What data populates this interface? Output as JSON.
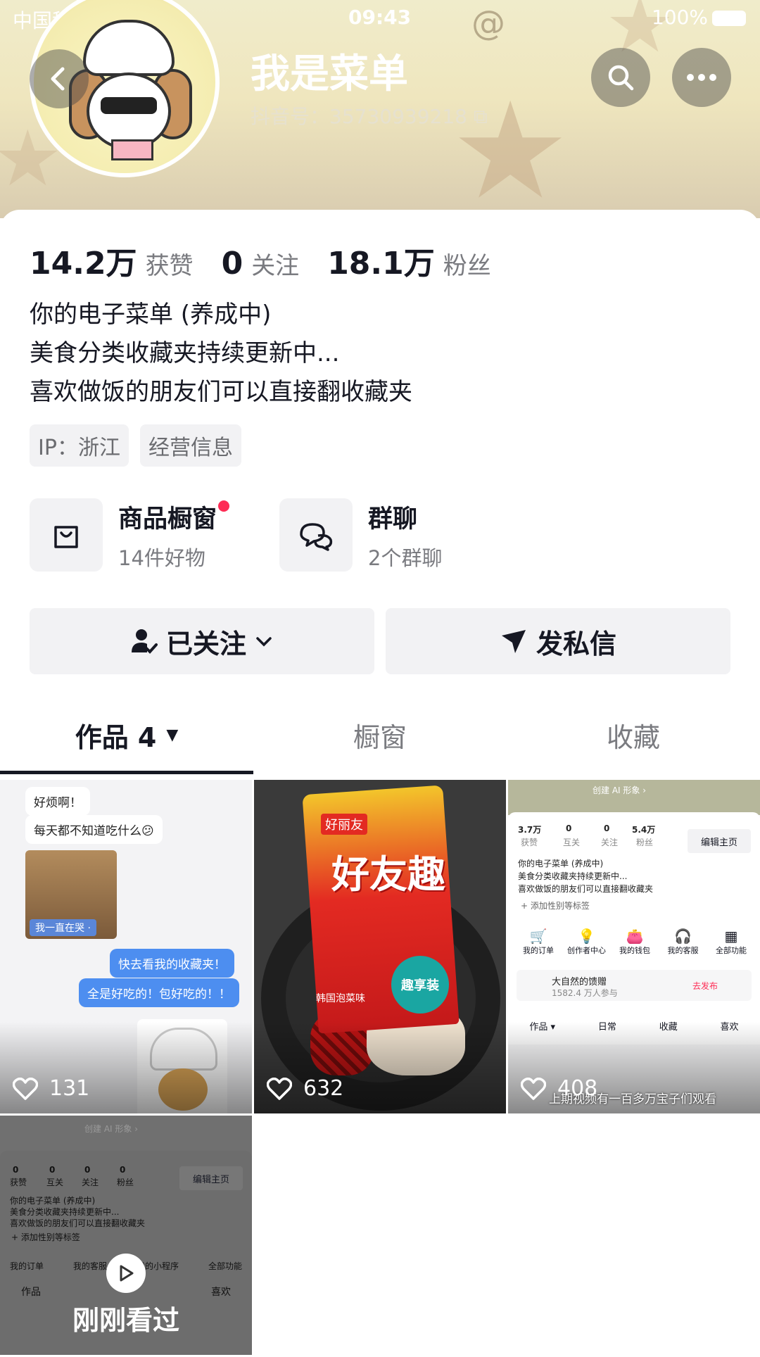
{
  "status_bar": {
    "carrier": "中国移动",
    "time": "09:43",
    "battery": "100%"
  },
  "profile": {
    "nickname": "我是菜单",
    "douyin_id": "抖音号：35730939218",
    "stats": [
      {
        "value": "14.2万",
        "label": "获赞"
      },
      {
        "value": "0",
        "label": "关注"
      },
      {
        "value": "18.1万",
        "label": "粉丝"
      }
    ],
    "bio": [
      "你的电子菜单 (养成中)",
      "美食分类收藏夹持续更新中...",
      "喜欢做饭的朋友们可以直接翻收藏夹"
    ],
    "tags": [
      "IP：浙江",
      "经营信息"
    ]
  },
  "entries": [
    {
      "title": "商品橱窗",
      "sub": "14件好物",
      "icon": "shopping-bag-icon"
    },
    {
      "title": "群聊",
      "sub": "2个群聊",
      "icon": "chat-bubbles-icon"
    }
  ],
  "actions": {
    "followed": "已关注",
    "message": "发私信"
  },
  "tabs": [
    {
      "label": "作品 4",
      "active": true
    },
    {
      "label": "橱窗",
      "active": false
    },
    {
      "label": "收藏",
      "active": false
    }
  ],
  "videos": [
    {
      "likes": "131",
      "chat": [
        "好烦啊！",
        "每天都不知道吃什么😕",
        "我一直在哭 ·",
        "快去看我的收藏夹！",
        "全是好吃的！包好吃的！！"
      ]
    },
    {
      "likes": "632",
      "bag": {
        "brand": "好丽友",
        "title": "好友趣",
        "flavor": "韩国泡菜味",
        "badge": "趣享装"
      }
    },
    {
      "likes": "408",
      "mini": {
        "create": "创建 AI 形象 ›",
        "stats": [
          {
            "v": "3.7万",
            "l": "获赞"
          },
          {
            "v": "0",
            "l": "互关"
          },
          {
            "v": "0",
            "l": "关注"
          },
          {
            "v": "5.4万",
            "l": "粉丝"
          }
        ],
        "edit": "编辑主页",
        "bio": [
          "你的电子菜单 (养成中)",
          "美食分类收藏夹持续更新中...",
          "喜欢做饭的朋友们可以直接翻收藏夹"
        ],
        "add_tag": "+ 添加性别等标签",
        "icons": [
          "我的订单",
          "创作者中心",
          "我的钱包",
          "我的客服",
          "全部功能"
        ],
        "banner_title": "大自然的馈赠",
        "banner_sub": "1582.4 万人参与",
        "banner_btn": "去发布",
        "tabs": [
          "作品 ▾",
          "日常",
          "收藏",
          "喜欢"
        ]
      },
      "caption": "上期视频有一百多万宝子们观看"
    },
    {
      "mini": {
        "create": "创建 AI 形象 ›",
        "stats": [
          {
            "v": "0",
            "l": "获赞"
          },
          {
            "v": "0",
            "l": "互关"
          },
          {
            "v": "0",
            "l": "关注"
          },
          {
            "v": "0",
            "l": "粉丝"
          }
        ],
        "edit": "编辑主页",
        "bio": [
          "你的电子菜单 (养成中)",
          "美食分类收藏夹持续更新中...",
          "喜欢做饭的朋友们可以直接翻收藏夹"
        ],
        "add_tag": "+ 添加性别等标签",
        "icons": [
          "我的订单",
          "我的客服",
          "我的小程序",
          "全部功能"
        ],
        "tabs": [
          "作品",
          "",
          "",
          "喜欢"
        ]
      },
      "label": "刚刚看过"
    }
  ]
}
